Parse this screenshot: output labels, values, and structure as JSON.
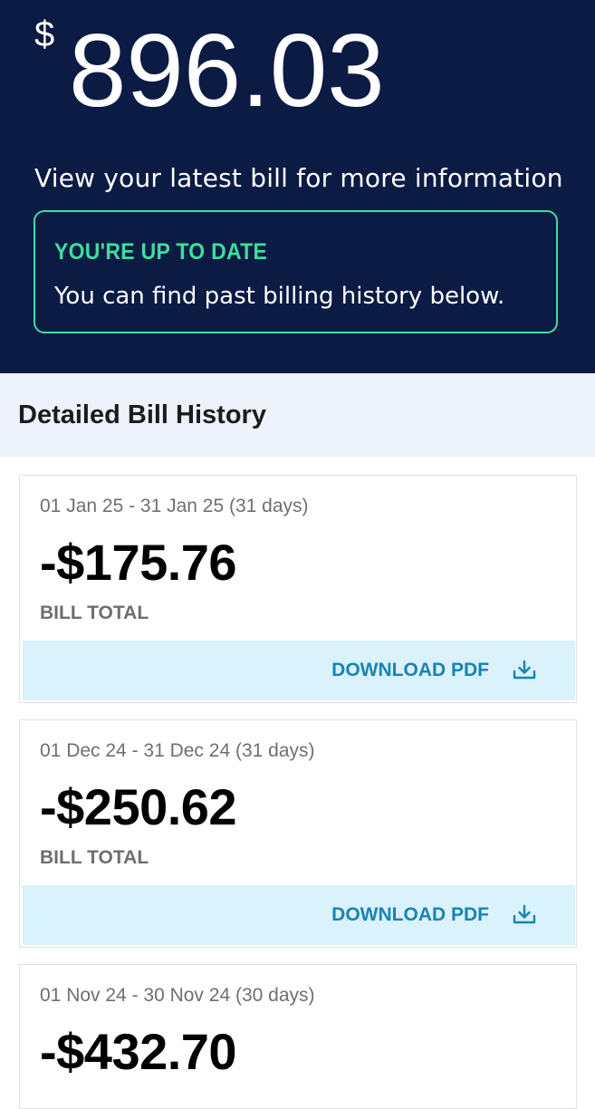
{
  "summary": {
    "currency_symbol": "$",
    "amount": "896.03",
    "message": "View your latest bill for more information"
  },
  "status": {
    "title": "YOU'RE UP TO DATE",
    "body": "You can find past billing history below.",
    "accent_color": "#3ddf9c"
  },
  "history": {
    "title": "Detailed Bill History",
    "bills": [
      {
        "period": "01 Jan 25 - 31 Jan 25 (31 days)",
        "amount": "-$175.76",
        "label": "BILL TOTAL",
        "action_label": "DOWNLOAD PDF",
        "action_icon": "download-icon"
      },
      {
        "period": "01 Dec 24 - 31 Dec 24 (31 days)",
        "amount": "-$250.62",
        "label": "BILL TOTAL",
        "action_label": "DOWNLOAD PDF",
        "action_icon": "download-icon"
      },
      {
        "period": "01 Nov 24 - 30 Nov 24 (30 days)",
        "amount": "-$432.70",
        "label": "",
        "action_label": "",
        "action_icon": ""
      }
    ]
  },
  "colors": {
    "hero_background": "#0c1b44",
    "section_background": "#eef3fb",
    "action_background": "#d9f2fb",
    "action_text": "#1883b6"
  }
}
